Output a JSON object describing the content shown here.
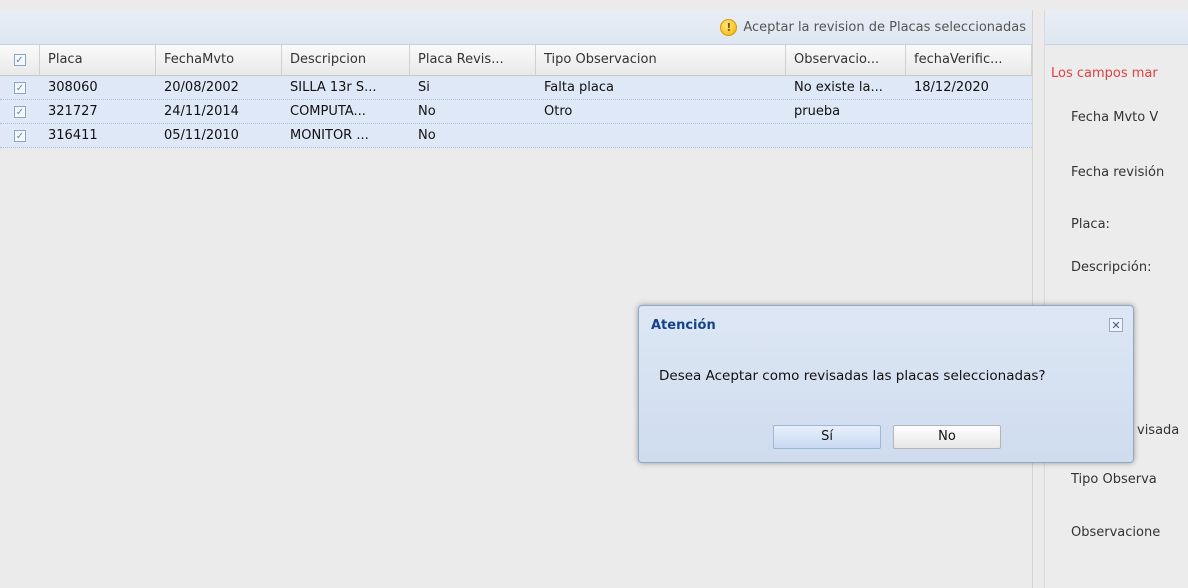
{
  "toolbar": {
    "accept_label": "Aceptar la revision de Placas seleccionadas"
  },
  "grid": {
    "columns": [
      "Placa",
      "FechaMvto",
      "Descripcion",
      "Placa Revis...",
      "Tipo Observacion",
      "Observacio...",
      "fechaVerific..."
    ],
    "rows": [
      {
        "placa": "308060",
        "fecha": "20/08/2002",
        "descripcion": "SILLA 13r S...",
        "revisada": "Si",
        "tipo": "Falta placa",
        "observacion": "No existe la...",
        "verificacion": "18/12/2020"
      },
      {
        "placa": "321727",
        "fecha": "24/11/2014",
        "descripcion": "COMPUTA...",
        "revisada": "No",
        "tipo": "Otro",
        "observacion": "prueba",
        "verificacion": ""
      },
      {
        "placa": "316411",
        "fecha": "05/11/2010",
        "descripcion": "MONITOR ...",
        "revisada": "No",
        "tipo": "",
        "observacion": "",
        "verificacion": ""
      }
    ]
  },
  "form": {
    "required_note": "Los campos mar",
    "labels": {
      "fecha_mvto": "Fecha Mvto V",
      "fecha_revision": "Fecha revisión",
      "placa": "Placa:",
      "descripcion": "Descripción:",
      "revisada": "visada",
      "tipo_observacion": "Tipo Observa",
      "observaciones": "Observacione"
    }
  },
  "dialog": {
    "title": "Atención",
    "message": "Desea Aceptar como revisadas las placas seleccionadas?",
    "yes_label": "Sí",
    "no_label": "No",
    "close_glyph": "✕"
  },
  "icons": {
    "checkbox_checked": "✓",
    "warning": "!"
  },
  "colors": {
    "required_text": "#e04040",
    "dialog_title": "#15428b",
    "row_selected": "#dfe8f6"
  }
}
